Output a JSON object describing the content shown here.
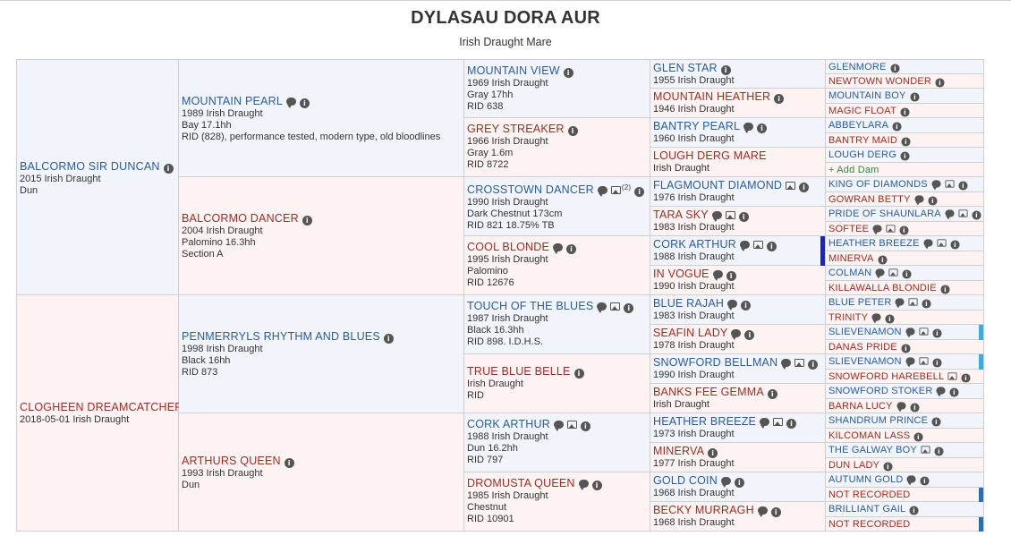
{
  "title": "DYLASAU DORA AUR",
  "subtitle": "Irish Draught Mare",
  "pedigree": {
    "g1": [
      {
        "name": "BALCORMO SIR DUNCAN",
        "lines": [
          "2015 Irish Draught",
          "Dun"
        ],
        "sex": "m",
        "icons": [
          "info-icon"
        ]
      },
      {
        "name": "CLOGHEEN DREAMCATCHER",
        "lines": [
          "2018-05-01 Irish Draught"
        ],
        "sex": "f",
        "icons": []
      }
    ],
    "g2": [
      {
        "name": "MOUNTAIN PEARL",
        "lines": [
          "1989 Irish Draught",
          "Bay 17.1hh",
          "RID (828), performance tested, modern type, old bloodlines"
        ],
        "sex": "m",
        "icons": [
          "comment-icon",
          "info-icon"
        ]
      },
      {
        "name": "BALCORMO DANCER",
        "lines": [
          "2004 Irish Draught",
          "Palomino 16.3hh",
          "Section A"
        ],
        "sex": "f",
        "icons": [
          "info-icon"
        ]
      },
      {
        "name": "PENMERRYLS RHYTHM AND BLUES",
        "lines": [
          "1998 Irish Draught",
          "Black 16hh",
          "RID 873"
        ],
        "sex": "m",
        "icons": [
          "info-icon"
        ]
      },
      {
        "name": "ARTHURS QUEEN",
        "lines": [
          "1993 Irish Draught",
          "Dun"
        ],
        "sex": "f",
        "icons": [
          "info-icon"
        ]
      }
    ],
    "g3": [
      {
        "name": "MOUNTAIN VIEW",
        "lines": [
          "1969 Irish Draught",
          "Gray 17hh",
          "RID 638"
        ],
        "sex": "m",
        "icons": [
          "info-icon"
        ]
      },
      {
        "name": "GREY STREAKER",
        "lines": [
          "1966 Irish Draught",
          "Gray 1.6m",
          "RID 8722"
        ],
        "sex": "f",
        "icons": [
          "info-icon"
        ]
      },
      {
        "name": "CROSSTOWN DANCER",
        "lines": [
          "1990 Irish Draught",
          "Dark Chestnut 173cm",
          "RID 821 18.75% TB"
        ],
        "sex": "m",
        "icons": [
          "comment-icon",
          "image-icon",
          "info-icon"
        ],
        "photo_count": "(2)"
      },
      {
        "name": "COOL BLONDE",
        "lines": [
          "1995 Irish Draught",
          "Palomino",
          "RID 12676"
        ],
        "sex": "f",
        "icons": [
          "comment-icon",
          "info-icon"
        ]
      },
      {
        "name": "TOUCH OF THE BLUES",
        "lines": [
          "1987 Irish Draught",
          "Black 16.3hh",
          "RID 898. I.D.H.S."
        ],
        "sex": "m",
        "icons": [
          "comment-icon",
          "image-icon",
          "info-icon"
        ]
      },
      {
        "name": "TRUE BLUE BELLE",
        "lines": [
          "Irish Draught",
          "RID"
        ],
        "sex": "f",
        "icons": [
          "info-icon"
        ]
      },
      {
        "name": "CORK ARTHUR",
        "lines": [
          "1988 Irish Draught",
          "Dun 16.2hh",
          "RID 797"
        ],
        "sex": "m",
        "icons": [
          "comment-icon",
          "image-icon",
          "info-icon"
        ],
        "marker": "#1a23c9"
      },
      {
        "name": "DROMUSTA QUEEN",
        "lines": [
          "1985 Irish Draught",
          "Chestnut",
          "RID 10901"
        ],
        "sex": "f",
        "icons": [
          "comment-icon",
          "info-icon"
        ]
      }
    ],
    "g4": [
      {
        "name": "GLEN STAR",
        "lines": [
          "1955 Irish Draught"
        ],
        "sex": "m",
        "icons": [
          "info-icon"
        ]
      },
      {
        "name": "MOUNTAIN HEATHER",
        "lines": [
          "1946 Irish Draught"
        ],
        "sex": "f",
        "icons": [
          "info-icon"
        ]
      },
      {
        "name": "BANTRY PEARL",
        "lines": [
          "1960 Irish Draught"
        ],
        "sex": "m",
        "icons": [
          "comment-icon",
          "info-icon"
        ]
      },
      {
        "name": "LOUGH DERG MARE",
        "lines": [
          "Irish Draught"
        ],
        "sex": "f",
        "icons": []
      },
      {
        "name": "FLAGMOUNT DIAMOND",
        "lines": [
          "1976 Irish Draught"
        ],
        "sex": "m",
        "icons": [
          "image-icon",
          "info-icon"
        ]
      },
      {
        "name": "TARA SKY",
        "lines": [
          "1983 Irish Draught"
        ],
        "sex": "f",
        "icons": [
          "comment-icon",
          "image-icon",
          "info-icon"
        ]
      },
      {
        "name": "CORK ARTHUR",
        "lines": [
          "1988 Irish Draught"
        ],
        "sex": "m",
        "icons": [
          "comment-icon",
          "image-icon",
          "info-icon"
        ],
        "marker": "#1a23c9"
      },
      {
        "name": "IN VOGUE",
        "lines": [
          "1990 Irish Draught"
        ],
        "sex": "f",
        "icons": [
          "comment-icon",
          "info-icon"
        ]
      },
      {
        "name": "BLUE RAJAH",
        "lines": [
          "1983 Irish Draught"
        ],
        "sex": "m",
        "icons": [
          "comment-icon",
          "info-icon"
        ]
      },
      {
        "name": "SEAFIN LADY",
        "lines": [
          "1978 Irish Draught"
        ],
        "sex": "f",
        "icons": [
          "comment-icon",
          "info-icon"
        ]
      },
      {
        "name": "SNOWFORD BELLMAN",
        "lines": [
          "1990 Irish Draught"
        ],
        "sex": "m",
        "icons": [
          "comment-icon",
          "image-icon",
          "info-icon"
        ]
      },
      {
        "name": "BANKS FEE GEMMA",
        "lines": [
          "Irish Draught"
        ],
        "sex": "f",
        "icons": [
          "info-icon"
        ]
      },
      {
        "name": "HEATHER BREEZE",
        "lines": [
          "1973 Irish Draught"
        ],
        "sex": "m",
        "icons": [
          "comment-icon",
          "image-icon",
          "info-icon"
        ]
      },
      {
        "name": "MINERVA",
        "lines": [
          "1977 Irish Draught"
        ],
        "sex": "f",
        "icons": [
          "info-icon"
        ]
      },
      {
        "name": "GOLD COIN",
        "lines": [
          "1968 Irish Draught"
        ],
        "sex": "m",
        "icons": [
          "comment-icon",
          "info-icon"
        ]
      },
      {
        "name": "BECKY MURRAGH",
        "lines": [
          "1968 Irish Draught"
        ],
        "sex": "f",
        "icons": [
          "comment-icon",
          "info-icon"
        ]
      }
    ],
    "g5": [
      {
        "name": "GLENMORE",
        "sex": "m",
        "icons": [
          "info-icon"
        ]
      },
      {
        "name": "NEWTOWN WONDER",
        "sex": "f",
        "icons": [
          "info-icon"
        ]
      },
      {
        "name": "MOUNTAIN BOY",
        "sex": "m",
        "icons": [
          "info-icon"
        ]
      },
      {
        "name": "MAGIC FLOAT",
        "sex": "f",
        "icons": [
          "info-icon"
        ]
      },
      {
        "name": "ABBEYLARA",
        "sex": "m",
        "icons": [
          "info-icon"
        ]
      },
      {
        "name": "BANTRY MAID",
        "sex": "f",
        "icons": [
          "info-icon"
        ]
      },
      {
        "name": "LOUGH DERG",
        "sex": "m",
        "icons": [
          "info-icon"
        ]
      },
      {
        "name": "+ Add Dam",
        "sex": "f",
        "icons": [],
        "add": true
      },
      {
        "name": "KING OF DIAMONDS",
        "sex": "m",
        "icons": [
          "comment-icon",
          "image-icon",
          "info-icon"
        ]
      },
      {
        "name": "GOWRAN BETTY",
        "sex": "f",
        "icons": [
          "comment-icon",
          "info-icon"
        ]
      },
      {
        "name": "PRIDE OF SHAUNLARA",
        "sex": "m",
        "icons": [
          "comment-icon",
          "image-icon",
          "info-icon"
        ]
      },
      {
        "name": "SOFTEE",
        "sex": "f",
        "icons": [
          "comment-icon",
          "image-icon",
          "info-icon"
        ]
      },
      {
        "name": "HEATHER BREEZE",
        "sex": "m",
        "icons": [
          "comment-icon",
          "image-icon",
          "info-icon"
        ],
        "marker": "#1a23c9"
      },
      {
        "name": "MINERVA",
        "sex": "f",
        "icons": [
          "info-icon"
        ],
        "marker": "#1a23c9"
      },
      {
        "name": "COLMAN",
        "sex": "m",
        "icons": [
          "comment-icon",
          "image-icon",
          "info-icon"
        ]
      },
      {
        "name": "KILLAWALLA BLONDIE",
        "sex": "f",
        "icons": [
          "info-icon"
        ]
      },
      {
        "name": "BLUE PETER",
        "sex": "m",
        "icons": [
          "comment-icon",
          "image-icon",
          "info-icon"
        ]
      },
      {
        "name": "TRINITY",
        "sex": "f",
        "icons": [
          "comment-icon",
          "info-icon"
        ]
      },
      {
        "name": "SLIEVENAMON",
        "sex": "m",
        "icons": [
          "comment-icon",
          "image-icon",
          "info-icon"
        ],
        "marker": "#3fa9e0"
      },
      {
        "name": "DANAS PRIDE",
        "sex": "f",
        "icons": [
          "info-icon"
        ]
      },
      {
        "name": "SLIEVENAMON",
        "sex": "m",
        "icons": [
          "comment-icon",
          "image-icon",
          "info-icon"
        ],
        "marker": "#3fa9e0"
      },
      {
        "name": "SNOWFORD HAREBELL",
        "sex": "f",
        "icons": [
          "image-icon",
          "info-icon"
        ]
      },
      {
        "name": "SNOWFORD STOKER",
        "sex": "m",
        "icons": [
          "comment-icon",
          "info-icon"
        ]
      },
      {
        "name": "BARNA LUCY",
        "sex": "f",
        "icons": [
          "comment-icon",
          "info-icon"
        ]
      },
      {
        "name": "SHANDRUM PRINCE",
        "sex": "m",
        "icons": [
          "info-icon"
        ]
      },
      {
        "name": "KILCOMAN LASS",
        "sex": "f",
        "icons": [
          "info-icon"
        ]
      },
      {
        "name": "THE GALWAY BOY",
        "sex": "m",
        "icons": [
          "image-icon",
          "info-icon"
        ]
      },
      {
        "name": "DUN LADY",
        "sex": "f",
        "icons": [
          "info-icon"
        ]
      },
      {
        "name": "AUTUMN GOLD",
        "sex": "m",
        "icons": [
          "comment-icon",
          "info-icon"
        ]
      },
      {
        "name": "NOT RECORDED",
        "sex": "f",
        "icons": [],
        "marker": "#2e6bb0"
      },
      {
        "name": "BRILLIANT GAIL",
        "sex": "m",
        "icons": [
          "info-icon"
        ]
      },
      {
        "name": "NOT RECORDED",
        "sex": "f",
        "icons": [],
        "marker": "#2e6bb0"
      }
    ]
  }
}
